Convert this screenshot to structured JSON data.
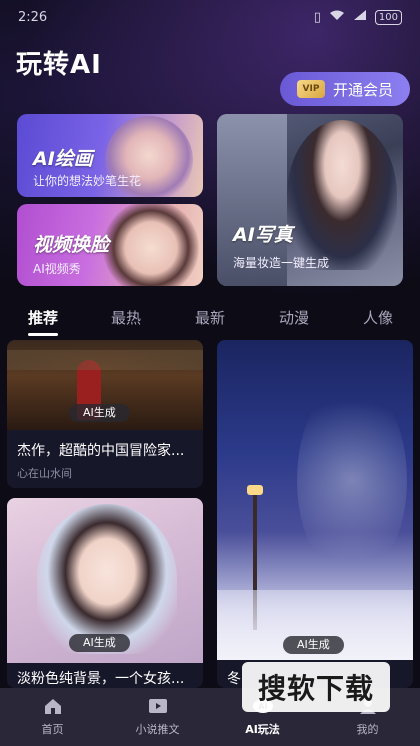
{
  "status_bar": {
    "time": "2:26",
    "battery": "100"
  },
  "header": {
    "title": "玩转AI",
    "vip_badge": "VIP",
    "vip_button_label": "开通会员"
  },
  "feature_cards": [
    {
      "title": "AI绘画",
      "subtitle": "让你的想法妙笔生花"
    },
    {
      "title": "视频换脸",
      "subtitle": "AI视频秀"
    },
    {
      "title": "AI写真",
      "subtitle": "海量妆造一键生成"
    }
  ],
  "tabs": [
    "推荐",
    "最热",
    "最新",
    "动漫",
    "人像"
  ],
  "feed": [
    {
      "tag": "AI生成",
      "title": "杰作，超酷的中国冒险家...",
      "author": "心在山水间"
    },
    {
      "tag": "AI生成",
      "title": "冬"
    },
    {
      "tag": "AI生成",
      "title": "淡粉色纯背景，一个女孩..."
    }
  ],
  "watermark": "搜软下载",
  "bottom_nav": [
    {
      "label": "首页",
      "icon": "home-icon"
    },
    {
      "label": "小说推文",
      "icon": "video-play-icon"
    },
    {
      "label": "AI玩法",
      "icon": "ai-icon"
    },
    {
      "label": "我的",
      "icon": "profile-icon"
    }
  ],
  "colors": {
    "background": "#0c0b16",
    "accent": "#7a6ae6",
    "nav_background": "#2a2838"
  }
}
